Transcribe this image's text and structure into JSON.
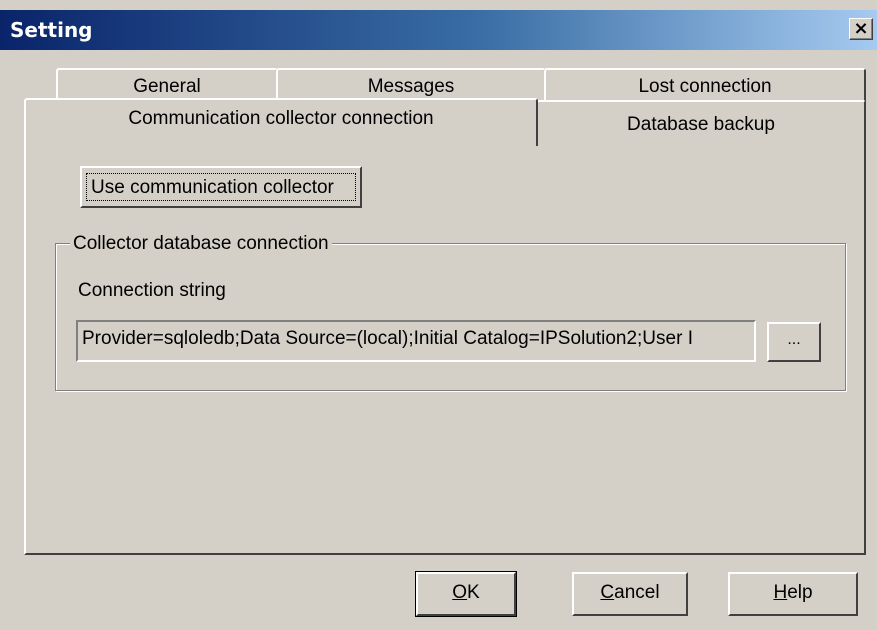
{
  "window": {
    "title": "Setting",
    "close_label": "×"
  },
  "tabs": {
    "row1": [
      "General",
      "Messages",
      "Lost connection"
    ],
    "row2": [
      "Communication collector connection",
      "Database backup"
    ],
    "active": "Communication collector connection"
  },
  "panel": {
    "use_collector_button": "Use communication collector",
    "group_title": "Collector database connection",
    "connection_label": "Connection string",
    "connection_value": "Provider=sqloledb;Data Source=(local);Initial Catalog=IPSolution2;User I",
    "browse_label": "..."
  },
  "buttons": {
    "ok": {
      "mnemonic": "O",
      "rest": "K"
    },
    "cancel": {
      "mnemonic": "C",
      "rest": "ancel"
    },
    "help": {
      "mnemonic": "H",
      "rest": "elp"
    }
  }
}
